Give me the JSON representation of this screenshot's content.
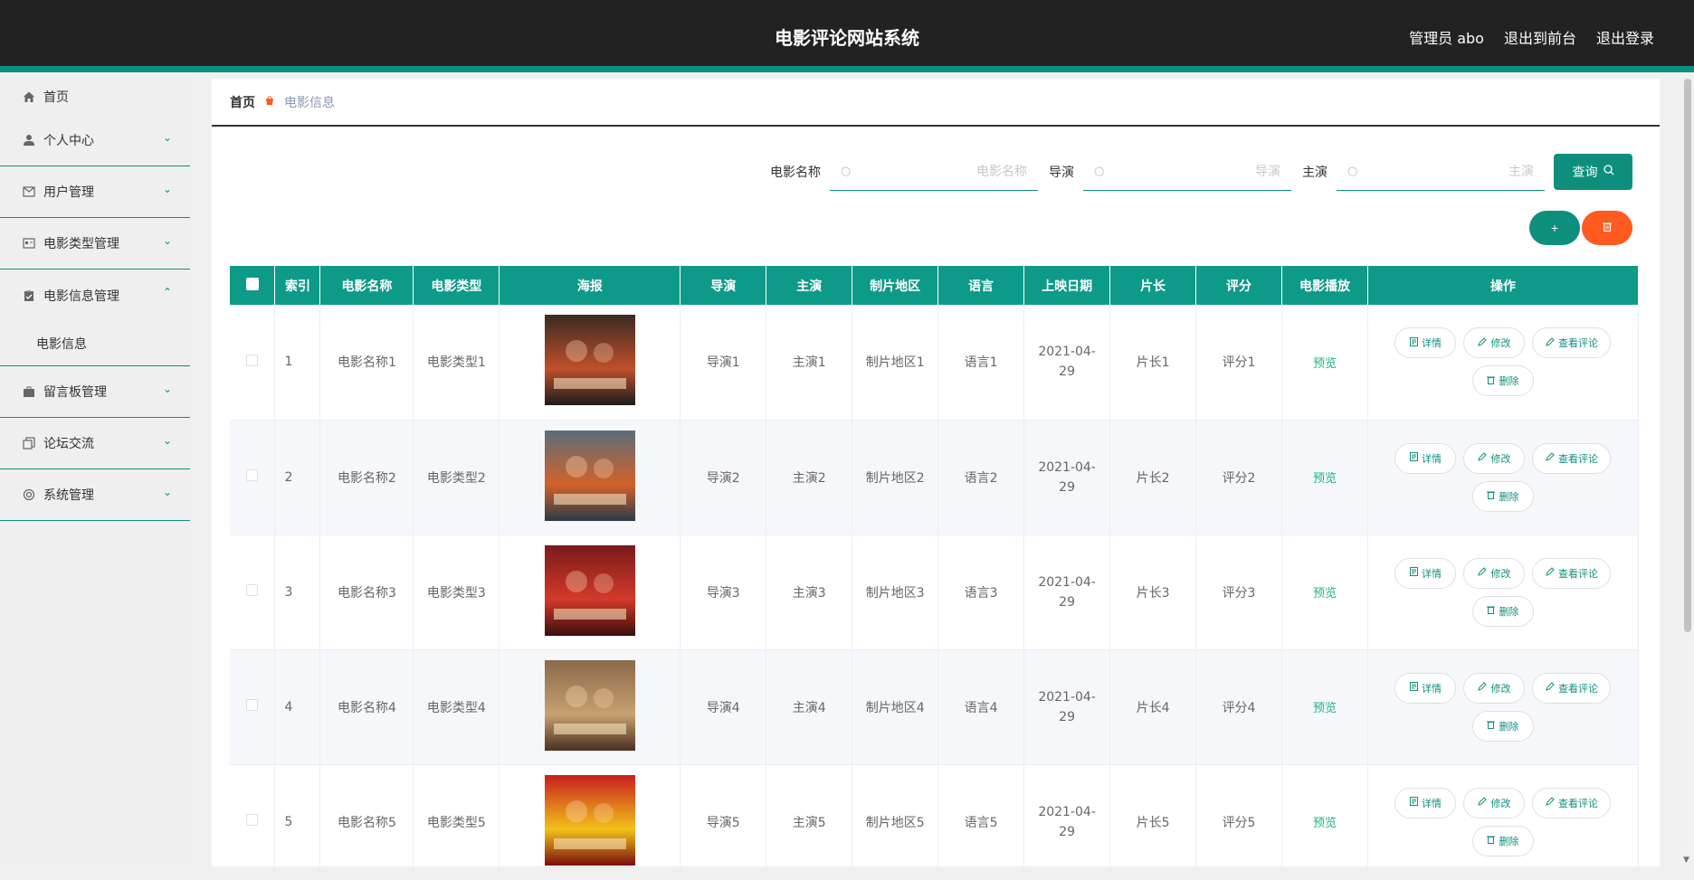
{
  "header": {
    "title": "电影评论网站系统",
    "admin": "管理员 abo",
    "to_front": "退出到前台",
    "logout": "退出登录"
  },
  "sidebar": {
    "items": [
      {
        "label": "首页",
        "icon": "home-icon"
      },
      {
        "label": "个人中心",
        "icon": "user-icon"
      },
      {
        "label": "用户管理",
        "icon": "mail-icon"
      },
      {
        "label": "电影类型管理",
        "icon": "id-card-icon"
      },
      {
        "label": "电影信息管理",
        "icon": "clipboard-icon",
        "expanded": true
      },
      {
        "label": "留言板管理",
        "icon": "briefcase-icon"
      },
      {
        "label": "论坛交流",
        "icon": "copy-icon"
      },
      {
        "label": "系统管理",
        "icon": "settings-icon"
      }
    ],
    "submenu": "电影信息"
  },
  "breadcrumb": {
    "home": "首页",
    "current": "电影信息"
  },
  "search": {
    "name_label": "电影名称",
    "name_placeholder": "电影名称",
    "director_label": "导演",
    "director_placeholder": "导演",
    "actor_label": "主演",
    "actor_placeholder": "主演",
    "query_label": "查询"
  },
  "actions": {
    "add": "+"
  },
  "table": {
    "headers": [
      "索引",
      "电影名称",
      "电影类型",
      "海报",
      "导演",
      "主演",
      "制片地区",
      "语言",
      "上映日期",
      "片长",
      "评分",
      "电影播放",
      "操作"
    ],
    "rows": [
      {
        "index": "1",
        "name": "电影名称1",
        "type": "电影类型1",
        "director": "导演1",
        "actor": "主演1",
        "region": "制片地区1",
        "language": "语言1",
        "date": "2021-04-29",
        "length": "片长1",
        "score": "评分1",
        "play": "预览"
      },
      {
        "index": "2",
        "name": "电影名称2",
        "type": "电影类型2",
        "director": "导演2",
        "actor": "主演2",
        "region": "制片地区2",
        "language": "语言2",
        "date": "2021-04-29",
        "length": "片长2",
        "score": "评分2",
        "play": "预览"
      },
      {
        "index": "3",
        "name": "电影名称3",
        "type": "电影类型3",
        "director": "导演3",
        "actor": "主演3",
        "region": "制片地区3",
        "language": "语言3",
        "date": "2021-04-29",
        "length": "片长3",
        "score": "评分3",
        "play": "预览"
      },
      {
        "index": "4",
        "name": "电影名称4",
        "type": "电影类型4",
        "director": "导演4",
        "actor": "主演4",
        "region": "制片地区4",
        "language": "语言4",
        "date": "2021-04-29",
        "length": "片长4",
        "score": "评分4",
        "play": "预览"
      },
      {
        "index": "5",
        "name": "电影名称5",
        "type": "电影类型5",
        "director": "导演5",
        "actor": "主演5",
        "region": "制片地区5",
        "language": "语言5",
        "date": "2021-04-29",
        "length": "片长5",
        "score": "评分5",
        "play": "预览"
      }
    ],
    "ops": {
      "detail": "详情",
      "edit": "修改",
      "review": "查看评论",
      "delete": "删除"
    }
  },
  "colors": {
    "accent": "#0e8f7d",
    "danger": "#ff5a1f",
    "header_bg": "#222222"
  }
}
